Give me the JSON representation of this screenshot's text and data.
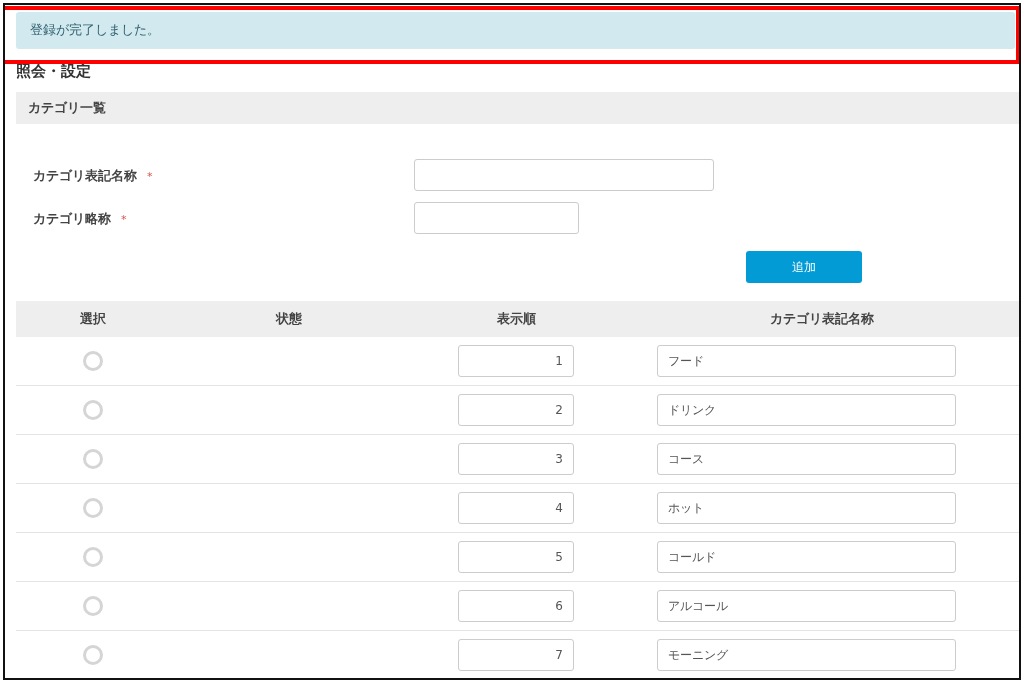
{
  "alert": {
    "message": "登録が完了しました。",
    "highlighted": true
  },
  "page_title": "照会・設定",
  "section": {
    "title": "カテゴリ一覧"
  },
  "form": {
    "fields": [
      {
        "label": "カテゴリ表記名称",
        "required": true,
        "kind": "wide"
      },
      {
        "label": "カテゴリ略称",
        "required": true,
        "kind": "narrow"
      }
    ],
    "required_mark": "*",
    "submit": "追加"
  },
  "table": {
    "columns": [
      "選択",
      "状態",
      "表示順",
      "カテゴリ表記名称"
    ],
    "rows": [
      {
        "selected": false,
        "order": "1",
        "name": "フード"
      },
      {
        "selected": false,
        "order": "2",
        "name": "ドリンク"
      },
      {
        "selected": false,
        "order": "3",
        "name": "コース"
      },
      {
        "selected": false,
        "order": "4",
        "name": "ホット"
      },
      {
        "selected": false,
        "order": "5",
        "name": "コールド"
      },
      {
        "selected": false,
        "order": "6",
        "name": "アルコール"
      },
      {
        "selected": false,
        "order": "7",
        "name": "モーニング"
      }
    ]
  }
}
